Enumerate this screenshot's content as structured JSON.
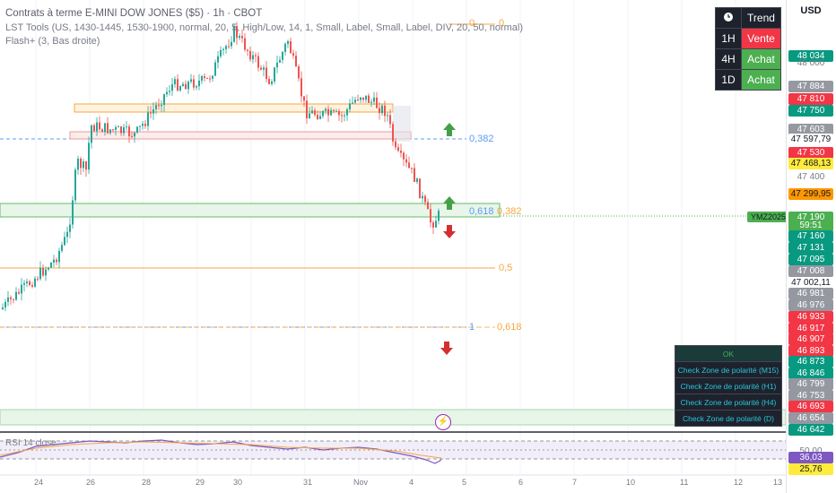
{
  "header": {
    "title": "Contrats à terme E-MINI DOW JONES ($5) · 1h · CBOT",
    "indicator1": "LST Tools (US, 1430-1445, 1530-1900, normal, 20, 5, High/Low, 14, 1, Small, Label, Small, Label, DIV, 20, 50, normal)",
    "indicator2": "Flash+ (3, Bas droite)"
  },
  "currency": "USD",
  "trend_table": {
    "header": "Trend",
    "rows": [
      {
        "tf": "1H",
        "signal": "Vente",
        "color": "#f23645"
      },
      {
        "tf": "4H",
        "signal": "Achat",
        "color": "#4caf50"
      },
      {
        "tf": "1D",
        "signal": "Achat",
        "color": "#4caf50"
      }
    ]
  },
  "fib_labels": [
    {
      "text": "0",
      "color": "#f5a742"
    },
    {
      "text": "0,382",
      "color": "#5b9cf6"
    },
    {
      "text": "0,618",
      "color": "#5b9cf6"
    },
    {
      "text": "0,382",
      "color": "#f5a742"
    },
    {
      "text": "0,5",
      "color": "#f5a742"
    },
    {
      "text": "1",
      "color": "#5b9cf6"
    },
    {
      "text": "0,618",
      "color": "#f5a742"
    }
  ],
  "symbol_tag": "YMZ2025",
  "price_labels": [
    {
      "text": "48 034",
      "bg": "#089981"
    },
    {
      "text": "48 000",
      "bg": "plain"
    },
    {
      "text": "47 884",
      "bg": "#9598a1"
    },
    {
      "text": "47 810",
      "bg": "#f23645"
    },
    {
      "text": "47 750",
      "bg": "#089981"
    },
    {
      "text": "47 603",
      "bg": "#9598a1"
    },
    {
      "text": "47 597,79",
      "bg": "#ffffff",
      "fg": "#131722"
    },
    {
      "text": "47 530",
      "bg": "#f23645"
    },
    {
      "text": "47 468,13",
      "bg": "#ffeb3b",
      "fg": "#131722"
    },
    {
      "text": "47 400",
      "bg": "plain"
    },
    {
      "text": "47 299,95",
      "bg": "#ff9800",
      "fg": "#131722"
    },
    {
      "text": "47 190",
      "bg": "#4caf50"
    },
    {
      "text": "59:51",
      "bg": "#4caf50"
    },
    {
      "text": "47 160",
      "bg": "#089981"
    },
    {
      "text": "47 131",
      "bg": "#089981"
    },
    {
      "text": "47 095",
      "bg": "#089981"
    },
    {
      "text": "47 008",
      "bg": "#9598a1"
    },
    {
      "text": "47 002,11",
      "bg": "#ffffff",
      "fg": "#131722"
    },
    {
      "text": "46 981",
      "bg": "#9598a1"
    },
    {
      "text": "46 976",
      "bg": "#9598a1"
    },
    {
      "text": "46 933",
      "bg": "#f23645"
    },
    {
      "text": "46 917",
      "bg": "#f23645"
    },
    {
      "text": "46 907",
      "bg": "#f23645"
    },
    {
      "text": "46 893",
      "bg": "#f23645"
    },
    {
      "text": "46 873",
      "bg": "#089981"
    },
    {
      "text": "46 846",
      "bg": "#089981"
    },
    {
      "text": "46 799",
      "bg": "#9598a1"
    },
    {
      "text": "46 753",
      "bg": "#9598a1"
    },
    {
      "text": "46 693",
      "bg": "#f23645"
    },
    {
      "text": "46 654",
      "bg": "#9598a1"
    },
    {
      "text": "46 642",
      "bg": "#089981"
    },
    {
      "text": "50,00",
      "bg": "plain"
    },
    {
      "text": "36,03",
      "bg": "#7e57c2"
    },
    {
      "text": "25,76",
      "bg": "#ffeb3b",
      "fg": "#131722"
    }
  ],
  "polarity_panel": {
    "ok": "OK",
    "rows": [
      "Check Zone de polarité (M15)",
      "Check Zone de polarité (H1)",
      "Check Zone de polarité (H4)",
      "Check Zone de polarité (D)"
    ]
  },
  "rsi_title": "RSI 14 close",
  "x_axis": [
    "24",
    "26",
    "28",
    "29",
    "30",
    "31",
    "Nov",
    "4",
    "5",
    "6",
    "7",
    "10",
    "11",
    "12",
    "13"
  ],
  "icons": [
    "up-arrow-icon",
    "down-arrow-icon",
    "flash-icon",
    "clock-icon"
  ]
}
